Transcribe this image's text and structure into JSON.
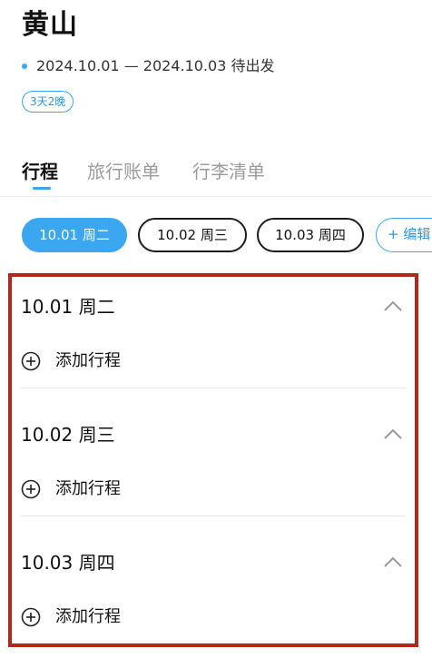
{
  "trip": {
    "title": "黄山",
    "dates": "2024.10.01 — 2024.10.03 待出发",
    "badge": "3天2晚"
  },
  "tabs": [
    {
      "label": "行程",
      "active": true
    },
    {
      "label": "旅行账单",
      "active": false
    },
    {
      "label": "行李清单",
      "active": false
    }
  ],
  "date_chips": [
    {
      "label": "10.01 周二",
      "active": true
    },
    {
      "label": "10.02 周三",
      "active": false
    },
    {
      "label": "10.03 周四",
      "active": false
    }
  ],
  "edit_chip": {
    "label": "+ 编辑"
  },
  "days": [
    {
      "heading": "10.01 周二",
      "add_label": "添加行程",
      "expanded": true
    },
    {
      "heading": "10.02 周三",
      "add_label": "添加行程",
      "expanded": true
    },
    {
      "heading": "10.03 周四",
      "add_label": "添加行程",
      "expanded": true
    }
  ],
  "icons": {
    "collapse": "chevron-up-icon",
    "add": "plus-circle-icon",
    "status": "status-dot-icon"
  },
  "colors": {
    "accent": "#3aa7f0",
    "highlight_frame": "#b3261e"
  }
}
